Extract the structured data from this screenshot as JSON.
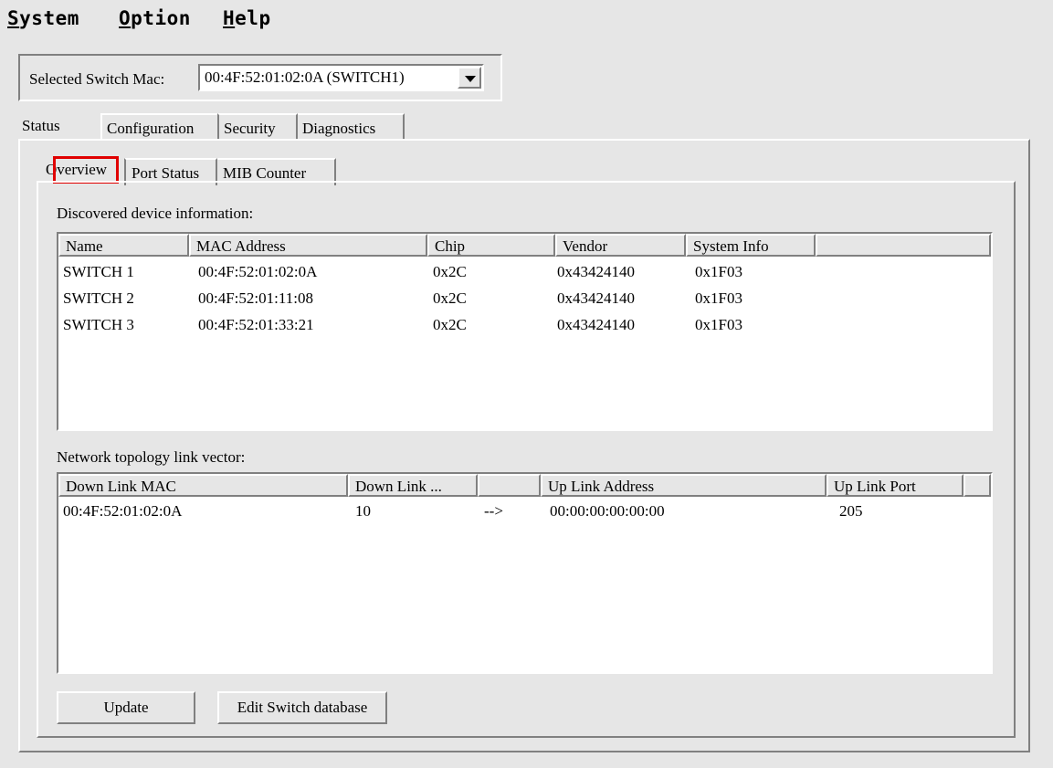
{
  "menu": {
    "items": [
      {
        "first": "S",
        "rest": "ystem"
      },
      {
        "first": "O",
        "rest": "ption"
      },
      {
        "first": "H",
        "rest": "elp"
      }
    ]
  },
  "selector": {
    "label": "Selected Switch Mac:",
    "value": "00:4F:52:01:02:0A (SWITCH1)"
  },
  "main_tabs": [
    "Status",
    "Configuration",
    "Security",
    "Diagnostics"
  ],
  "sub_tabs": [
    "Overview",
    "Port Status",
    "MIB Counter"
  ],
  "devices": {
    "title": "Discovered device information:",
    "columns": [
      "Name",
      "MAC Address",
      "Chip",
      "Vendor",
      "System Info"
    ],
    "rows": [
      [
        "SWITCH 1",
        "00:4F:52:01:02:0A",
        "0x2C",
        "0x43424140",
        "0x1F03"
      ],
      [
        "SWITCH 2",
        "00:4F:52:01:11:08",
        "0x2C",
        "0x43424140",
        "0x1F03"
      ],
      [
        "SWITCH 3",
        "00:4F:52:01:33:21",
        "0x2C",
        "0x43424140",
        "0x1F03"
      ]
    ]
  },
  "topology": {
    "title": "Network topology link vector:",
    "columns": [
      "Down Link MAC",
      "Down Link ...",
      "",
      "Up Link Address",
      "Up Link Port"
    ],
    "rows": [
      [
        "00:4F:52:01:02:0A",
        "10",
        "-->",
        "00:00:00:00:00:00",
        "205"
      ]
    ]
  },
  "buttons": {
    "update": "Update",
    "edit": "Edit Switch database"
  }
}
